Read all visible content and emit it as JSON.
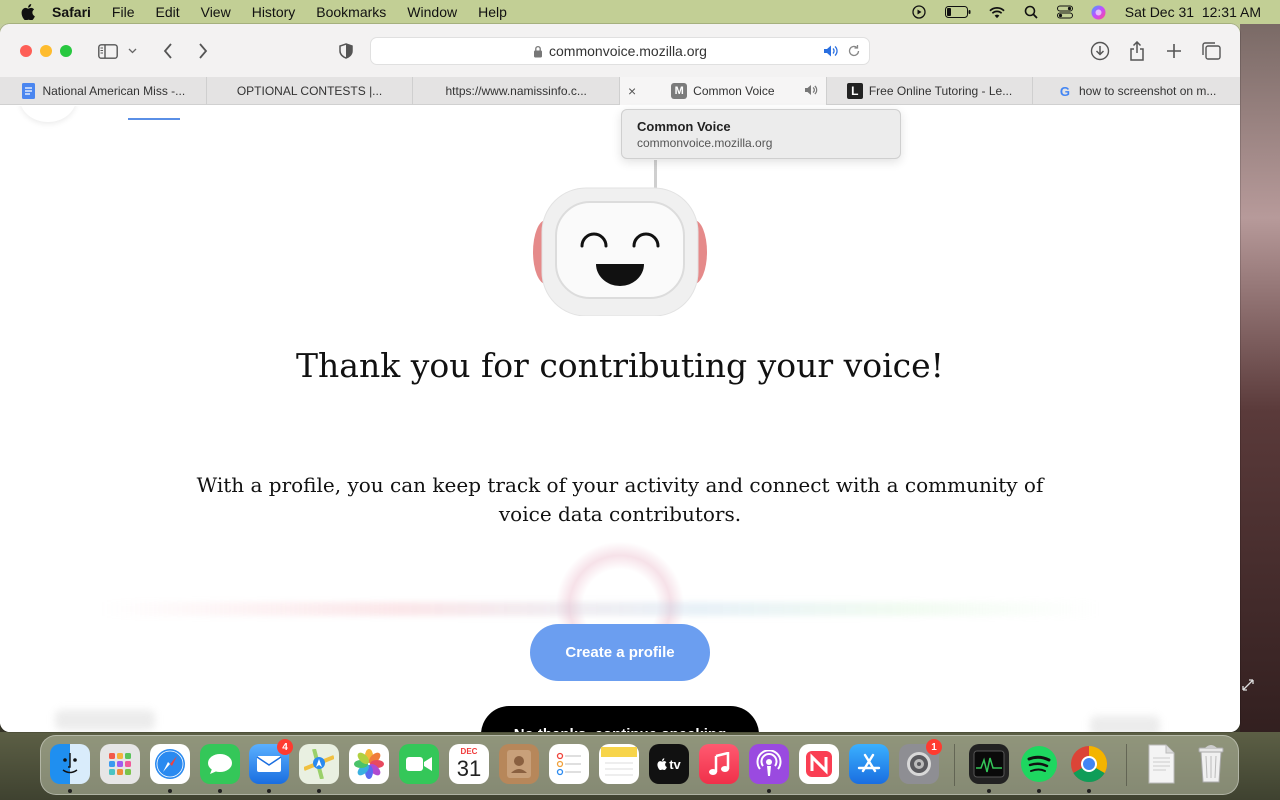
{
  "menubar": {
    "app_name": "Safari",
    "items": [
      "File",
      "Edit",
      "View",
      "History",
      "Bookmarks",
      "Window",
      "Help"
    ],
    "clock": "Sat Dec 31  12:31 AM"
  },
  "browser": {
    "url": "commonvoice.mozilla.org",
    "tabs": [
      {
        "label": "National American Miss -...",
        "icon": "google-docs-icon"
      },
      {
        "label": "OPTIONAL CONTESTS |...",
        "icon": "none"
      },
      {
        "label": "https://www.namissinfo.c...",
        "icon": "none"
      },
      {
        "label": "Common Voice",
        "icon": "common-voice-icon",
        "favicon_letter": "M"
      },
      {
        "label": "Free Online Tutoring - Le...",
        "icon": "learn-to-be-icon",
        "favicon_letter": "L"
      },
      {
        "label": "how to screenshot on m...",
        "icon": "google-icon",
        "favicon_letter": "G"
      }
    ],
    "tooltip": {
      "title": "Common Voice",
      "url": "commonvoice.mozilla.org"
    }
  },
  "page": {
    "headline": "Thank you for contributing your voice!",
    "subtext": "With a profile, you can keep track of your activity and connect with a community of voice data contributors.",
    "create_profile_label": "Create a profile",
    "no_thanks_label": "No thanks, continue speaking",
    "accent_color": "#6b9ef0"
  },
  "dock": {
    "calendar_month": "DEC",
    "calendar_day": "31",
    "mail_badge": "4",
    "settings_badge": "1",
    "tv_label": "tv"
  }
}
